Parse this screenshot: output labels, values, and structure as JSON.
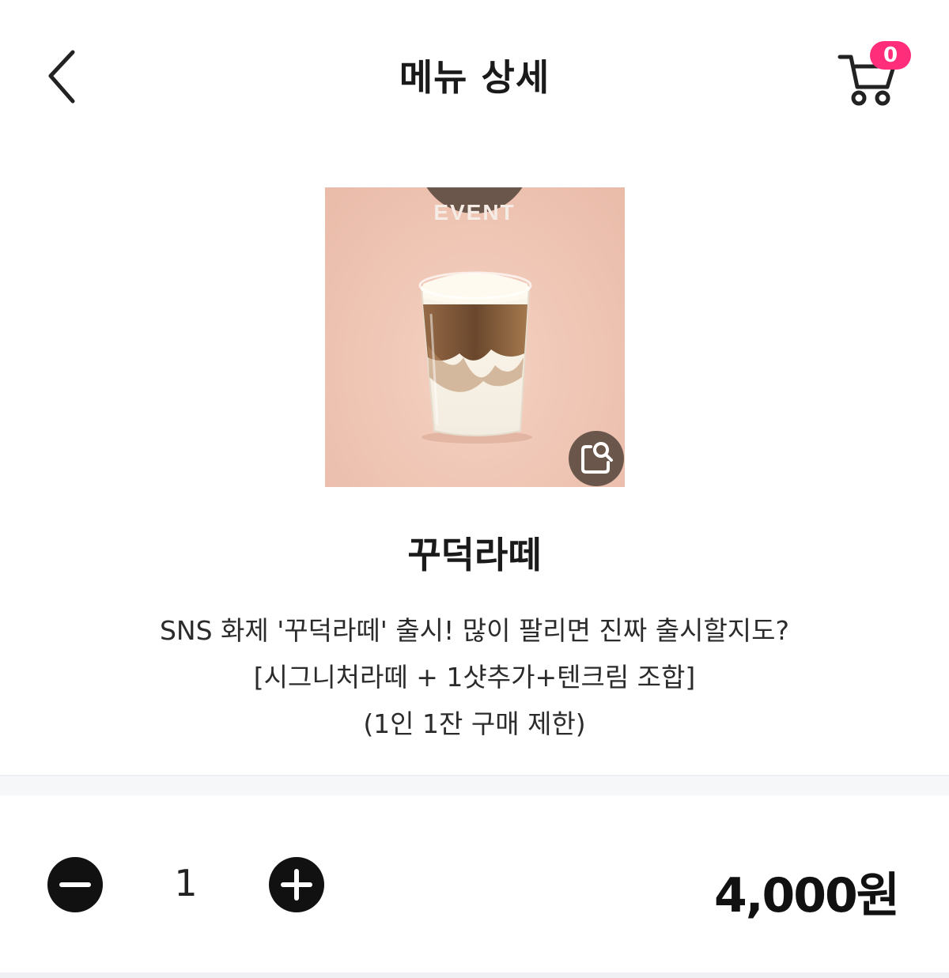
{
  "header": {
    "title": "메뉴 상세",
    "back_icon": "chevron-left-icon",
    "cart_icon": "shopping-cart-icon",
    "cart_count": "0"
  },
  "product": {
    "badge": "EVENT",
    "name": "꾸덕라떼",
    "description_lines": [
      "SNS 화제 '꾸덕라떼' 출시! 많이 팔리면 진짜 출시할지도?",
      "[시그니처라떼 + 1샷추가+텐크림 조합]",
      "(1인 1잔 구매 제한)"
    ],
    "zoom_icon": "zoom-image-icon"
  },
  "order": {
    "quantity": "1",
    "price": "4,000원",
    "minus_icon": "minus-circle-icon",
    "plus_icon": "plus-circle-icon"
  },
  "colors": {
    "badge_bg": "#ff2d7a",
    "image_bg": "#efc5b4",
    "event_badge_bg": "#6b564b",
    "button_bg": "#111111"
  }
}
